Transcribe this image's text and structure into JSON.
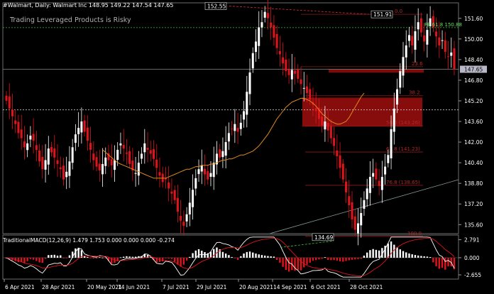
{
  "header": {
    "symbol_line": "#Walmart, Daily:  Walmart Inc  148.95 149.22 147.54 147.65",
    "risk_note": "Trading Leveraged Products is Risky"
  },
  "colors": {
    "background": "#000000",
    "bull": "#ffffff",
    "bear": "#e0141c",
    "ma": "#e08a1e",
    "fib_line": "#8c1a1a",
    "fib_text": "#b32828",
    "fe_line": "#3fbf3f",
    "zone": "#8e0d0d",
    "price_box": "#b8b8c8"
  },
  "price_axis": {
    "ticks": [
      "151.60",
      "150.00",
      "148.40",
      "146.80",
      "145.20",
      "143.60",
      "142.00",
      "140.40",
      "138.80",
      "137.20",
      "135.60"
    ],
    "current": "147.65",
    "range": [
      134.9,
      152.8
    ]
  },
  "time_axis": {
    "labels": [
      "6 Apr 2021",
      "28 Apr 2021",
      "20 May 2021",
      "14 Jun 2021",
      "7 Jul 2021",
      "29 Jul 2021",
      "20 Aug 2021",
      "14 Sep 2021",
      "6 Oct 2021",
      "28 Oct 2021"
    ]
  },
  "annotations": {
    "high_label": "152.55",
    "recent_high_label": "151.91",
    "low_label": "134.69",
    "fe_label": "FE 61.8  150.88",
    "fib_levels": [
      {
        "label": "0.0",
        "price": 151.91
      },
      {
        "label": "23.6",
        "price": 147.85
      },
      {
        "label": "38.2",
        "price": 145.6
      },
      {
        "label": "50.0  (143.26)",
        "price": 143.26
      },
      {
        "label": "61.8  (141.23)",
        "price": 141.23
      },
      {
        "label": "76.8  (138.65)",
        "price": 138.65
      },
      {
        "label": "100.0",
        "price": 134.69
      }
    ]
  },
  "macd": {
    "label": "TraditionalMACD(12,26,9) 1.479 1.753 0.000 0.000 0.000 -0.274",
    "ticks": [
      "2.791",
      "0.000",
      "-2.655"
    ]
  },
  "chart_data": {
    "type": "candlestick",
    "title": "",
    "series_close": [
      145.2,
      144.6,
      144.0,
      143.4,
      142.7,
      142.3,
      141.6,
      141.9,
      142.5,
      142.1,
      141.4,
      140.5,
      139.9,
      140.6,
      141.5,
      141.2,
      140.8,
      140.3,
      139.9,
      139.1,
      139.7,
      140.5,
      141.6,
      142.6,
      143.1,
      143.6,
      142.8,
      142.1,
      141.4,
      140.6,
      140.1,
      139.8,
      140.3,
      140.8,
      140.6,
      140.2,
      140.6,
      141.4,
      141.9,
      141.5,
      141.1,
      140.3,
      139.8,
      139.6,
      140.4,
      141.1,
      141.9,
      141.4,
      141.1,
      140.7,
      140.0,
      139.4,
      138.9,
      139.1,
      138.4,
      138.0,
      137.5,
      136.6,
      135.9,
      135.5,
      136.4,
      137.3,
      138.3,
      139.2,
      139.9,
      140.2,
      139.5,
      139.1,
      139.6,
      140.4,
      141.1,
      140.8,
      141.3,
      142.0,
      142.7,
      143.0,
      143.4,
      142.8,
      143.5,
      144.4,
      145.9,
      147.4,
      148.9,
      149.8,
      150.9,
      151.3,
      152.1,
      151.6,
      150.9,
      150.1,
      149.3,
      148.8,
      148.1,
      147.5,
      147.2,
      147.6,
      147.3,
      146.9,
      146.5,
      146.2,
      145.8,
      145.3,
      144.9,
      144.4,
      143.8,
      143.3,
      143.6,
      142.9,
      142.3,
      141.7,
      140.9,
      140.0,
      139.1,
      138.1,
      137.1,
      136.0,
      135.2,
      135.7,
      136.5,
      137.5,
      138.4,
      139.3,
      139.6,
      139.1,
      138.6,
      139.3,
      140.1,
      141.0,
      143.0,
      144.6,
      146.1,
      147.5,
      148.6,
      149.5,
      150.3,
      149.5,
      150.6,
      151.3,
      150.5,
      149.8,
      150.7,
      151.6,
      150.9,
      150.2,
      149.5,
      149.9,
      149.0,
      148.6,
      148.95,
      147.65
    ],
    "ma": [
      141.4,
      141.2,
      141.0,
      140.8,
      140.6,
      140.4,
      140.3,
      140.2,
      140.1,
      140.0,
      139.9,
      139.8,
      139.7,
      139.6,
      139.5,
      139.4,
      139.3,
      139.2,
      139.2,
      139.2,
      139.2,
      139.2,
      139.3,
      139.4,
      139.5,
      139.6,
      139.7,
      139.8,
      139.9,
      139.9,
      140.0,
      140.1,
      140.1,
      140.2,
      140.2,
      140.2,
      140.3,
      140.3,
      140.4,
      140.5,
      140.6,
      140.6,
      140.7,
      140.7,
      140.8,
      140.9,
      141.0,
      141.0,
      141.1,
      141.2,
      141.3,
      141.5,
      141.7,
      142.0,
      142.3,
      142.6,
      143.0,
      143.4,
      143.8,
      144.1,
      144.4,
      144.7,
      144.9,
      145.1,
      145.2,
      145.3,
      145.4,
      145.4,
      145.3,
      145.2,
      145.0,
      144.8,
      144.5,
      144.2,
      144.0,
      143.8,
      143.6,
      143.5,
      143.4,
      143.4,
      143.5,
      143.6,
      143.9,
      144.3,
      144.7,
      145.1,
      145.5,
      145.8
    ],
    "ylim": [
      134.9,
      152.8
    ],
    "macd_range": [
      -3.2,
      3.4
    ]
  }
}
